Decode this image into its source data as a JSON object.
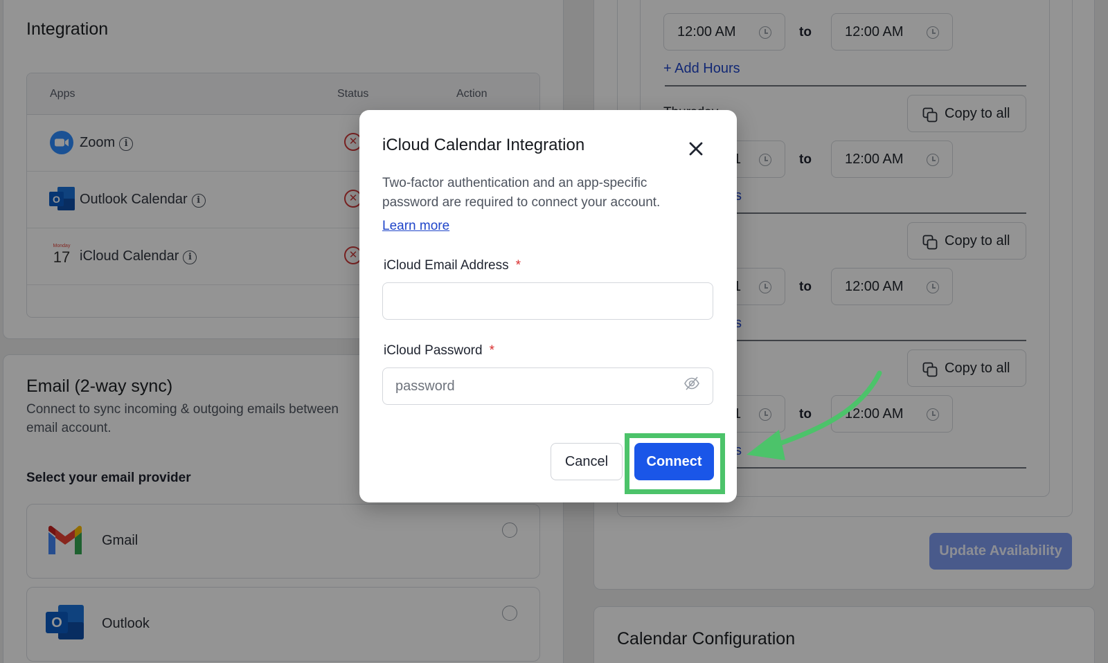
{
  "integration": {
    "title": "Integration",
    "headers": {
      "apps": "Apps",
      "status": "Status",
      "action": "Action"
    },
    "apps": [
      {
        "name": "Zoom"
      },
      {
        "name": "Outlook Calendar"
      },
      {
        "name": "iCloud Calendar",
        "icon_day": "Monday",
        "icon_date": "17"
      }
    ]
  },
  "email": {
    "title": "Email (2-way sync)",
    "description": "Connect to sync incoming & outgoing emails between",
    "description2": "email account.",
    "select_label": "Select your email provider",
    "providers": [
      {
        "name": "Gmail"
      },
      {
        "name": "Outlook"
      }
    ]
  },
  "availability": {
    "time_value": "12:00 AM",
    "to_label": "to",
    "add_hours": "+ Add Hours",
    "copy_to_all": "Copy to all",
    "update_button": "Update Availability",
    "partial_day_label": "Thursday",
    "partial_time": "1",
    "partial_link": "s"
  },
  "calendar_config": {
    "title": "Calendar Configuration"
  },
  "modal": {
    "title": "iCloud Calendar Integration",
    "description": "Two-factor authentication and an app-specific password are required to connect your account.",
    "learn_more": "Learn more",
    "email_label": "iCloud Email Address",
    "email_value": "",
    "password_label": "iCloud Password",
    "password_placeholder": "password",
    "required_mark": "*",
    "cancel": "Cancel",
    "connect": "Connect"
  },
  "colors": {
    "primary": "#1a56e8",
    "highlight": "#4cc36a",
    "error": "#d23b3b"
  }
}
